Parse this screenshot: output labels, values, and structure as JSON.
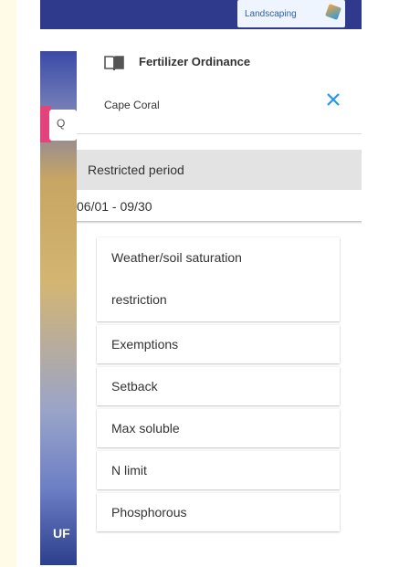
{
  "header": {
    "title": "Fertilizer Ordinance",
    "location": "Cape Coral",
    "book_icon": "book-open-icon",
    "close_icon": "close-icon",
    "close_color": "#2196f3",
    "logo_right_text": "Landscaping"
  },
  "restricted_period": {
    "label": "Restricted period",
    "value": "06/01 - 09/30"
  },
  "sections": [
    {
      "label_line1": "Weather/soil saturation",
      "label_line2": "restriction"
    },
    {
      "label": "Exemptions"
    },
    {
      "label": "Setback"
    },
    {
      "label": "Max soluble"
    },
    {
      "label": "N limit"
    },
    {
      "label": "Phosphorous"
    }
  ],
  "map": {
    "search_glyph": "Q",
    "bottom_text": "UF"
  }
}
